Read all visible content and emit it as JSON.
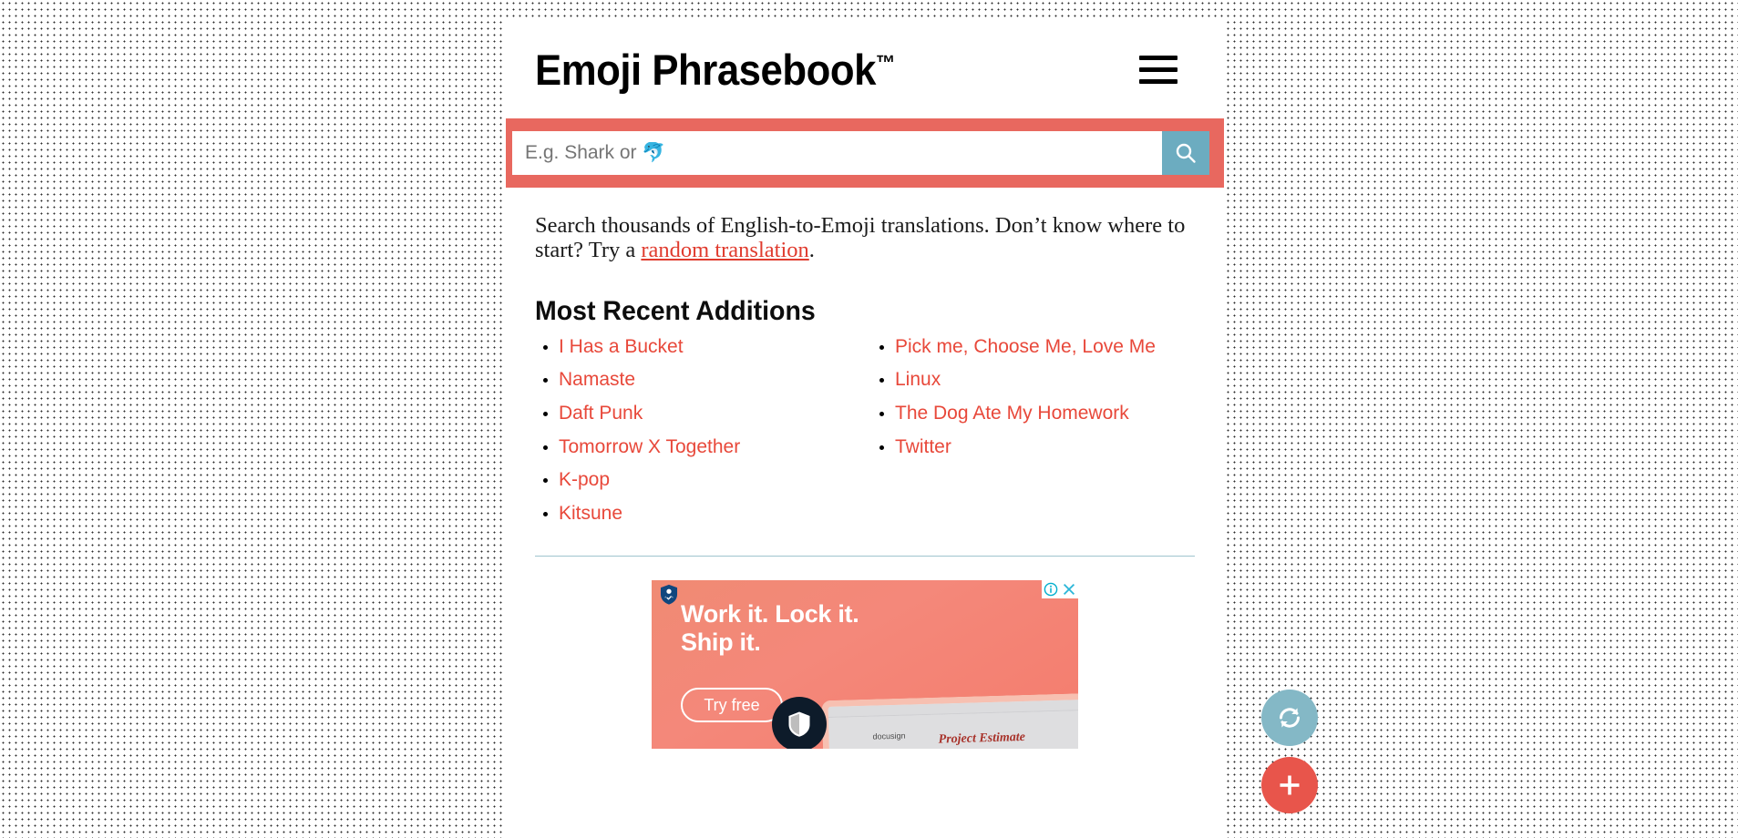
{
  "background": {
    "pattern": "dotted-grid",
    "dot_color": "#2b2b2b",
    "page_color": "#ffffff"
  },
  "header": {
    "title": "Emoji Phrasebook",
    "trademark": "™",
    "menu_icon": "hamburger-icon"
  },
  "search": {
    "placeholder": "E.g. Shark or 🐬",
    "value": "",
    "submit_icon": "search-icon",
    "band_color": "#e8685f",
    "button_color": "#6cacc0"
  },
  "intro": {
    "text_before": "Search thousands of English-to-Emoji translations. Don’t know where to start? Try a ",
    "link_text": "random translation",
    "text_after": ".",
    "link_color": "#e03b2e"
  },
  "recent": {
    "heading": "Most Recent Additions",
    "link_color": "#e8483a",
    "column_left": [
      "I Has a Bucket",
      "Namaste",
      "Daft Punk",
      "Tomorrow X Together",
      "K-pop",
      "Kitsune"
    ],
    "column_right": [
      "Pick me, Choose Me, Love Me",
      "Linux",
      "The Dog Ate My Homework",
      "Twitter"
    ]
  },
  "ad": {
    "headline_line1": "Work it. Lock it.",
    "headline_line2": "Ship it.",
    "cta_label": "Try free",
    "adchoices_icon": "info-icon",
    "close_icon": "close-icon",
    "advertiser_icon": "shield-person-icon",
    "product_icon": "shield-icon",
    "doc_title": "Project Estimate",
    "doc_logo_label": "docusign",
    "background_color": "#f4887a"
  },
  "fabs": {
    "refresh": {
      "icon": "refresh-icon",
      "color": "#84b8c6"
    },
    "add": {
      "icon": "plus-icon",
      "color": "#e8554b"
    }
  }
}
